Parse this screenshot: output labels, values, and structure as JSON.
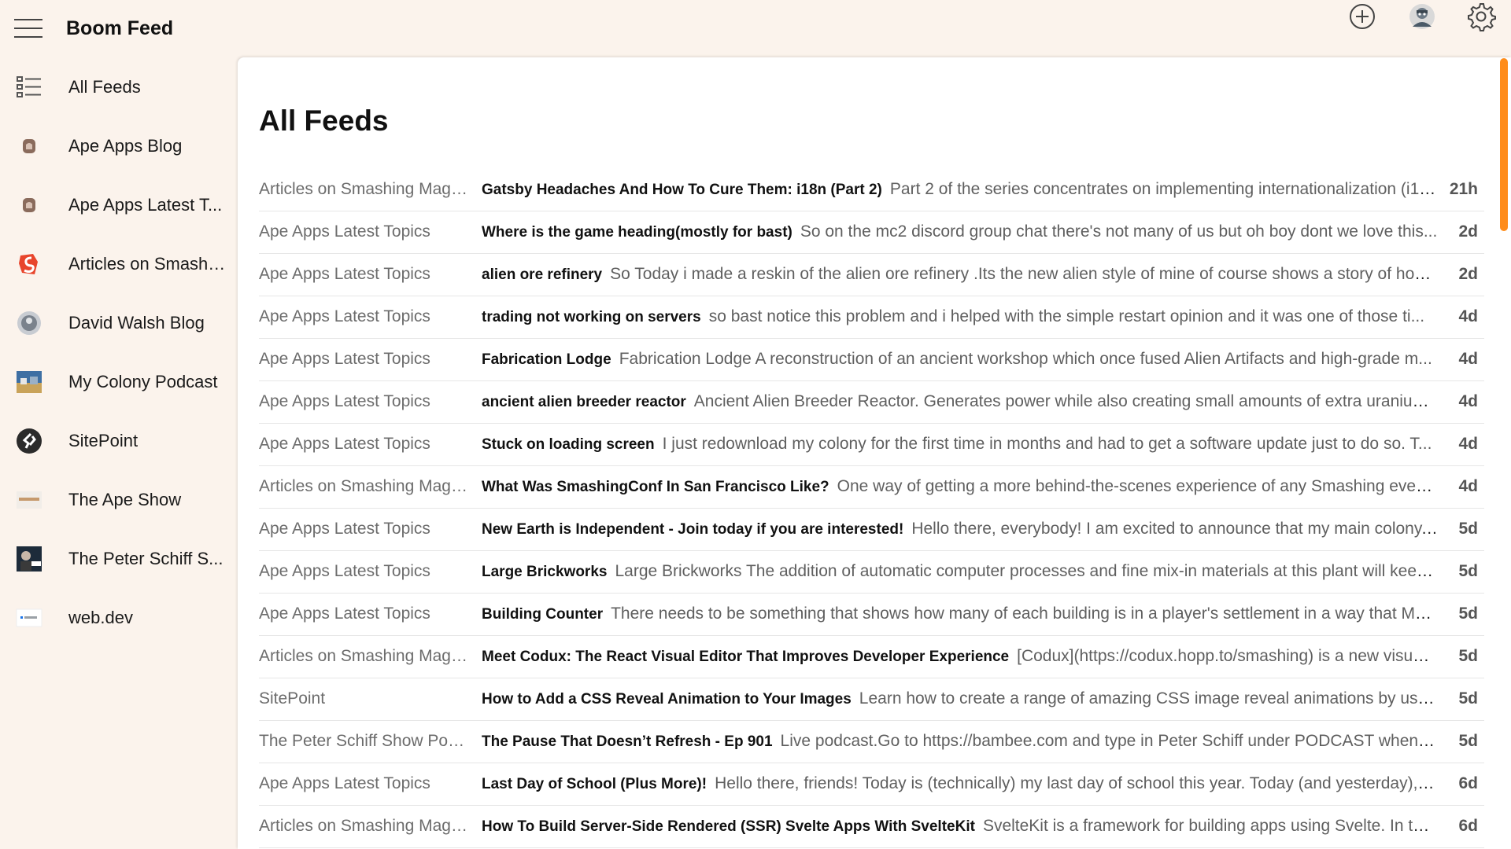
{
  "app": {
    "title": "Boom Feed"
  },
  "toolbar": {
    "menu_icon": "hamburger-menu-icon",
    "add_icon": "plus-circle-icon",
    "avatar_icon": "user-avatar-icon",
    "settings_icon": "gear-icon"
  },
  "sidebar": {
    "items": [
      {
        "label": "All Feeds",
        "icon": "list-icon"
      },
      {
        "label": "Ape Apps Blog",
        "icon": "ape-apps-icon"
      },
      {
        "label": "Ape Apps Latest T...",
        "icon": "ape-apps-icon"
      },
      {
        "label": "Articles on Smashi...",
        "icon": "smashing-magazine-icon"
      },
      {
        "label": "David Walsh Blog",
        "icon": "david-walsh-icon"
      },
      {
        "label": "My Colony Podcast",
        "icon": "my-colony-icon"
      },
      {
        "label": "SitePoint",
        "icon": "sitepoint-icon"
      },
      {
        "label": "The Ape Show",
        "icon": "ape-show-icon"
      },
      {
        "label": "The Peter Schiff S...",
        "icon": "peter-schiff-icon"
      },
      {
        "label": "web.dev",
        "icon": "web-dev-icon"
      }
    ]
  },
  "main": {
    "title": "All Feeds",
    "rows": [
      {
        "source": "Articles on Smashing Maga...",
        "title": "Gatsby Headaches And How To Cure Them: i18n (Part 2)",
        "snippet": "Part 2 of the series concentrates on implementing internationalization (i18n...",
        "age": "21h"
      },
      {
        "source": "Ape Apps Latest Topics",
        "title": "Where is the game heading(mostly for bast)",
        "snippet": "So on the mc2 discord group chat there's not many of us but oh boy dont we love this...",
        "age": "2d"
      },
      {
        "source": "Ape Apps Latest Topics",
        "title": "alien ore refinery",
        "snippet": "So Today i made a reskin of the alien ore refinery .Its the new alien style of mine of course shows a story of how ...",
        "age": "2d"
      },
      {
        "source": "Ape Apps Latest Topics",
        "title": "trading not working on servers",
        "snippet": "so bast notice this problem and i helped with the simple restart opinion and it was one of those ti...",
        "age": "4d"
      },
      {
        "source": "Ape Apps Latest Topics",
        "title": "Fabrication Lodge",
        "snippet": "Fabrication Lodge A reconstruction of an ancient workshop which once fused Alien Artifacts and high-grade m...",
        "age": "4d"
      },
      {
        "source": "Ape Apps Latest Topics",
        "title": "ancient alien breeder reactor",
        "snippet": "Ancient Alien Breeder Reactor. Generates power while also creating small amounts of extra uranium. ...",
        "age": "4d"
      },
      {
        "source": "Ape Apps Latest Topics",
        "title": "Stuck on loading screen",
        "snippet": "I just redownload my colony for the first time in months and had to get a software update just to do so. T...",
        "age": "4d"
      },
      {
        "source": "Articles on Smashing Maga...",
        "title": "What Was SmashingConf In San Francisco Like?",
        "snippet": "One way of getting a more behind-the-scenes experience of any Smashing event is ...",
        "age": "4d"
      },
      {
        "source": "Ape Apps Latest Topics",
        "title": "New Earth is Independent - Join today if you are interested!",
        "snippet": "Hello there, everybody! I am excited to announce that my main colony, ...",
        "age": "5d"
      },
      {
        "source": "Ape Apps Latest Topics",
        "title": "Large Brickworks",
        "snippet": "Large Brickworks The addition of automatic computer processes and fine mix-in materials at this plant will keep...",
        "age": "5d"
      },
      {
        "source": "Ape Apps Latest Topics",
        "title": "Building Counter",
        "snippet": "There needs to be something that shows how many of each building is in a player's settlement in a way that My ...",
        "age": "5d"
      },
      {
        "source": "Articles on Smashing Maga...",
        "title": "Meet Codux: The React Visual Editor That Improves Developer Experience",
        "snippet": "[Codux](https://codux.hopp.to/smashing) is a new visual I...",
        "age": "5d"
      },
      {
        "source": "SitePoint",
        "title": "How to Add a CSS Reveal Animation to Your Images",
        "snippet": "Learn how to create a range of amazing CSS image reveal animations by using ...",
        "age": "5d"
      },
      {
        "source": "The Peter Schiff Show Podc...",
        "title": "The Pause That Doesn’t Refresh - Ep 901",
        "snippet": "Live podcast.Go to https://bambee.com and type in Peter Schiff under PODCAST when yo...",
        "age": "5d"
      },
      {
        "source": "Ape Apps Latest Topics",
        "title": "Last Day of School (Plus More)!",
        "snippet": "Hello there, friends! Today is (technically) my last day of school this year. Today (and yesterday), we...",
        "age": "6d"
      },
      {
        "source": "Articles on Smashing Maga...",
        "title": "How To Build Server-Side Rendered (SSR) Svelte Apps With SvelteKit",
        "snippet": "SvelteKit is a framework for building apps using Svelte. In this ...",
        "age": "6d"
      }
    ]
  },
  "colors": {
    "background": "#fbf3ec",
    "panel": "#ffffff",
    "accent": "#ff8c1a"
  }
}
